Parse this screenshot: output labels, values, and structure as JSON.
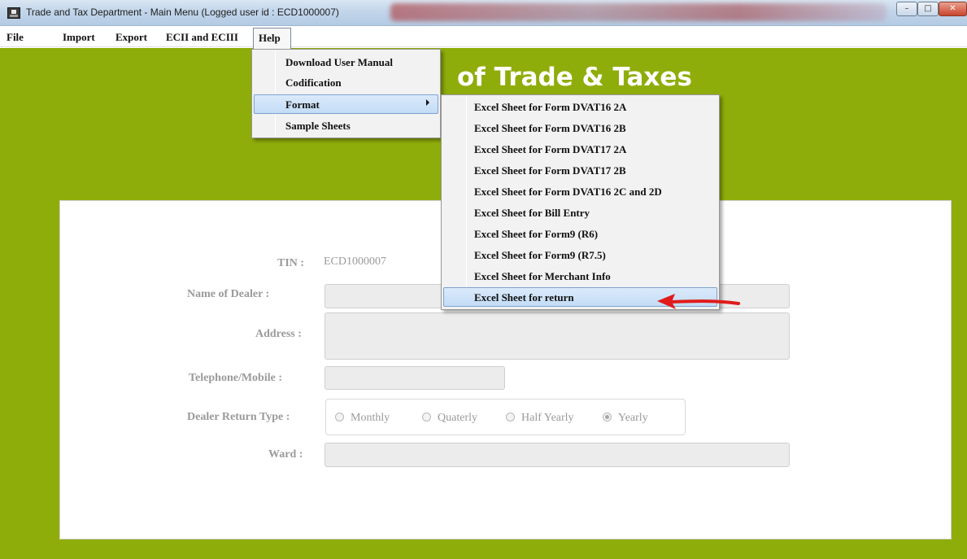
{
  "window": {
    "title": "Trade and Tax Department - Main Menu (Logged user id : ECD1000007)",
    "minimize_glyph": "–",
    "maximize_glyph": "□",
    "close_glyph": "✕"
  },
  "menubar": {
    "file": "File",
    "import": "Import",
    "export": "Export",
    "ecii": "ECII and ECIII",
    "help": "Help"
  },
  "help_menu": {
    "items": [
      "Download User Manual",
      "Codification",
      "Format",
      "Sample Sheets"
    ],
    "active": "Format"
  },
  "format_submenu": {
    "items": [
      "Excel Sheet for Form DVAT16 2A",
      "Excel Sheet for Form DVAT16 2B",
      "Excel Sheet for Form DVAT17 2A",
      "Excel Sheet for Form DVAT17 2B",
      "Excel Sheet for Form DVAT16 2C and 2D",
      "Excel Sheet for Bill Entry",
      "Excel Sheet for Form9 (R6)",
      "Excel Sheet for Form9 (R7.5)",
      "Excel Sheet for Merchant Info",
      "Excel Sheet for return"
    ],
    "highlighted": "Excel Sheet for return"
  },
  "banner": {
    "title_visible": "of Trade & Taxes"
  },
  "form": {
    "tin_label": "TIN :",
    "tin_value": "ECD1000007",
    "dealer_name_label": "Name of Dealer :",
    "dealer_name_value": "",
    "address_label": "Address :",
    "address_value": "",
    "phone_label": "Telephone/Mobile :",
    "phone_value": "",
    "return_type_label": "Dealer Return Type :",
    "return_type_options": [
      "Monthly",
      "Quaterly",
      "Half Yearly",
      "Yearly"
    ],
    "return_type_selected": "Yearly",
    "ward_label": "Ward :",
    "ward_value": ""
  },
  "colors": {
    "background_green": "#8fad0a",
    "highlight_blue": "#c3dcf6",
    "arrow_red": "#e01b1b"
  }
}
